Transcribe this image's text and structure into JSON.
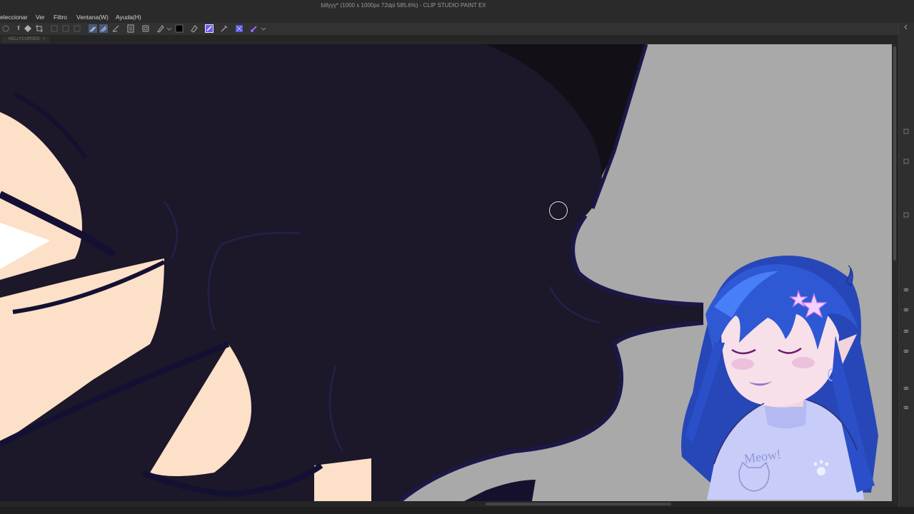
{
  "window": {
    "title": "billyyy* (1000 x 1000px 72dpi 585.6%) - CLIP STUDIO PAINT EX"
  },
  "menu": {
    "items": [
      "eleccionar",
      "Ver",
      "Filtro",
      "Ventana(W)",
      "Ayuda(H)"
    ]
  },
  "toolbar": {
    "icons": [
      "select-all-icon",
      "move-icon",
      "transform-icon",
      "deselect-icon",
      "crop-icon",
      "pen-vector-icon",
      "ruler-icon",
      "layer-icon",
      "settings-icon",
      "pen-icon",
      "color-swatch-icon",
      "eraser-icon",
      "fill-icon",
      "dropper-icon",
      "layer-property-icon",
      "pen-pressure-icon"
    ],
    "accent": "#6a5bff"
  },
  "tab": {
    "label": "KELLYCURSED"
  },
  "colors": {
    "hair": "#1c1729",
    "skin": "#fde0c8",
    "background_gray": "#a8a8a8",
    "lineart": "#1b1847"
  }
}
